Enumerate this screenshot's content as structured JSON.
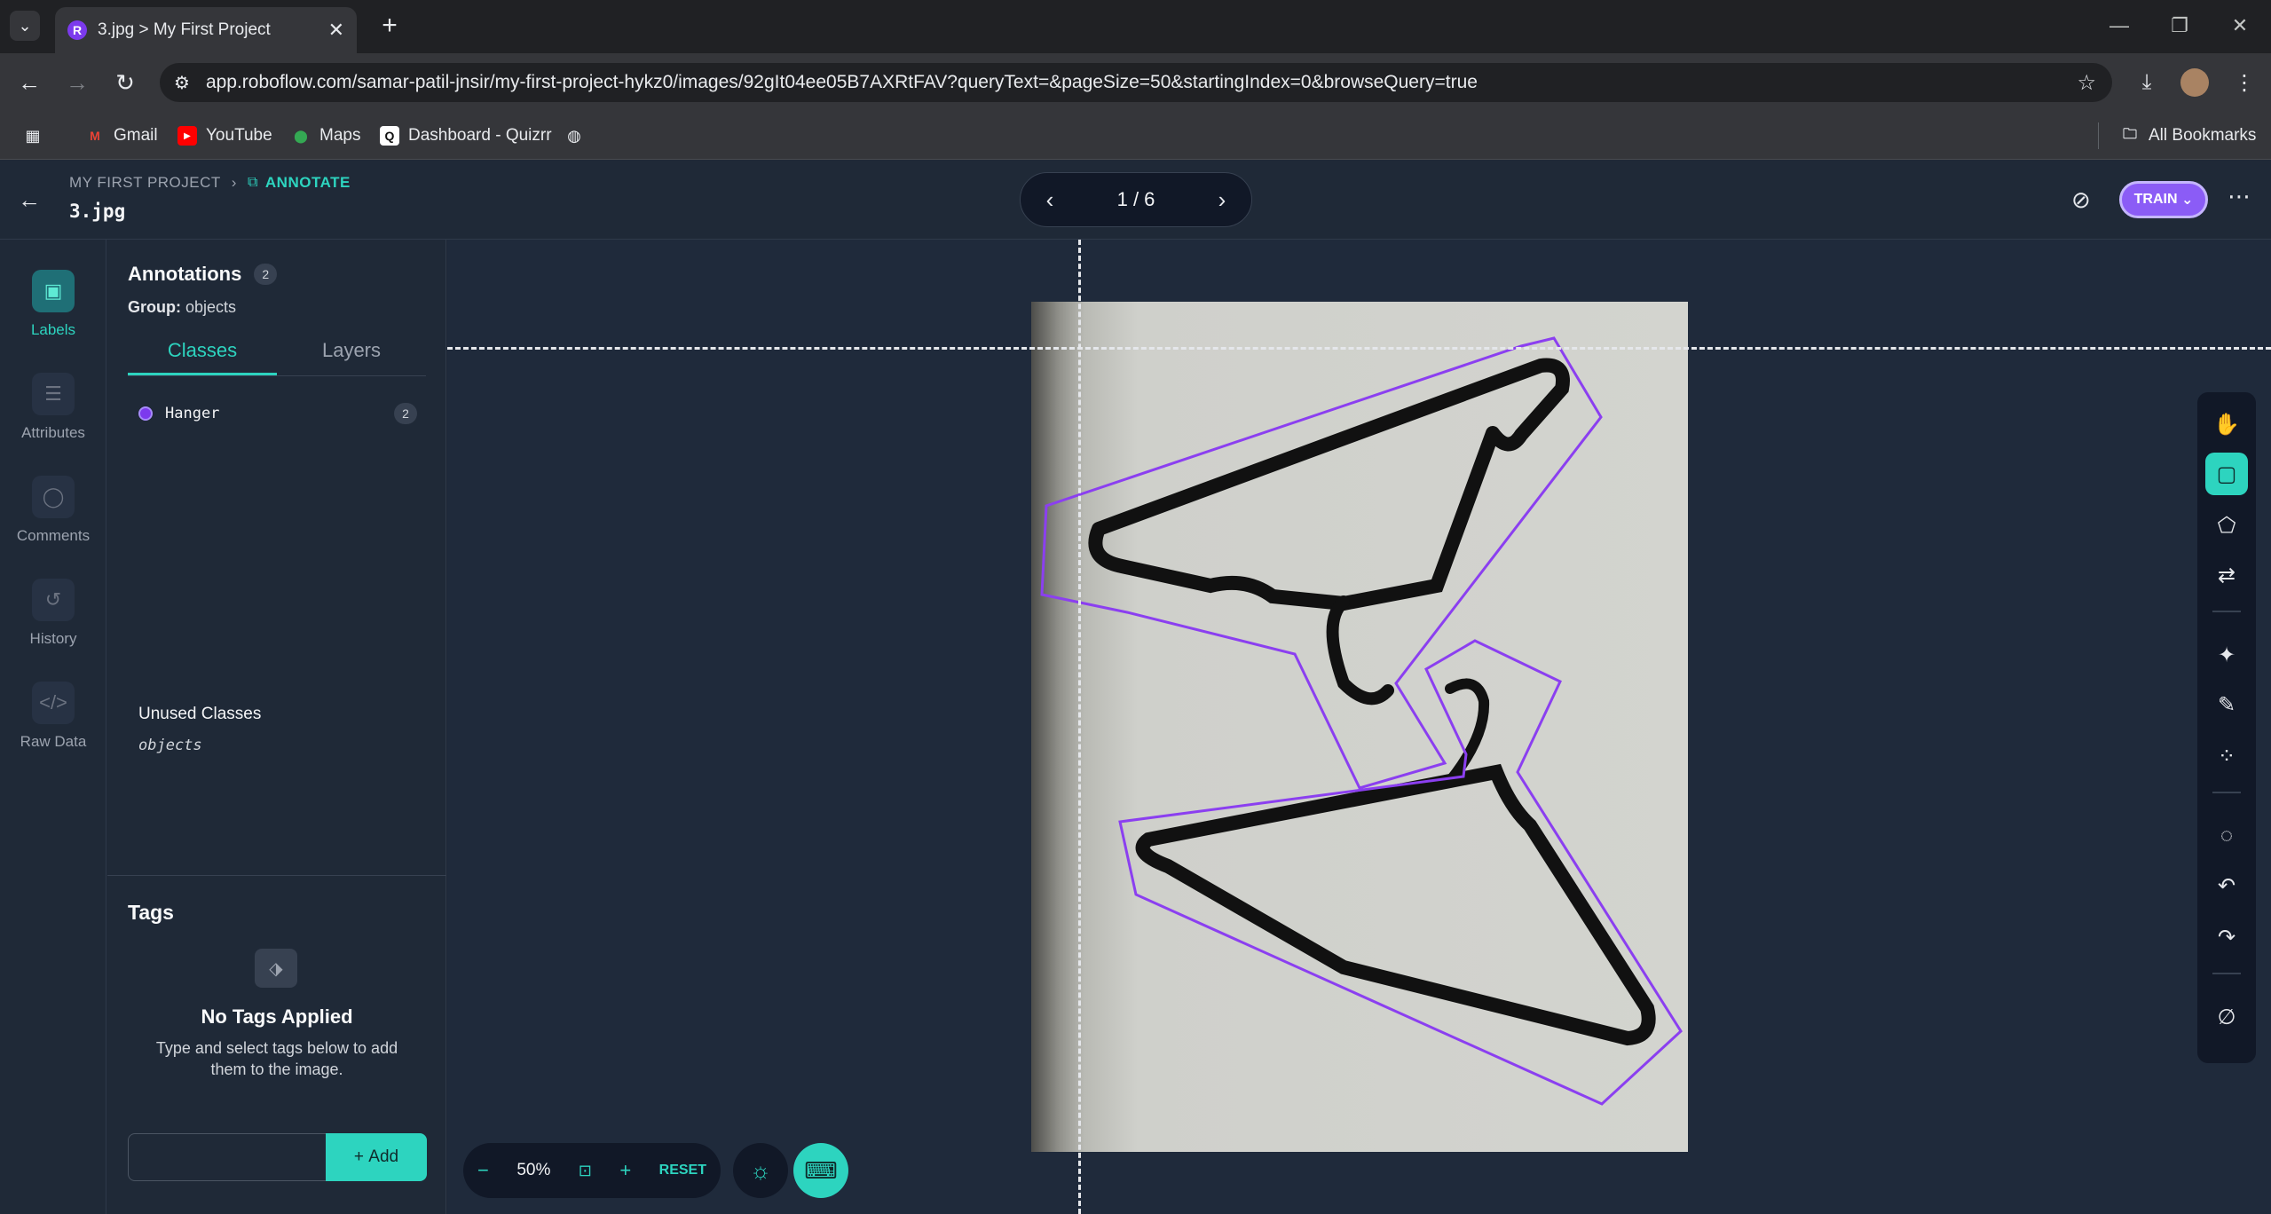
{
  "browser": {
    "tab_title": "3.jpg > My First Project",
    "url": "app.roboflow.com/samar-patil-jnsir/my-first-project-hykz0/images/92gIt04ee05B7AXRtFAV?queryText=&pageSize=50&startingIndex=0&browseQuery=true",
    "bookmarks": [
      "Gmail",
      "YouTube",
      "Maps",
      "Dashboard - Quizrr"
    ],
    "all_bookmarks": "All Bookmarks"
  },
  "header": {
    "project": "MY FIRST PROJECT",
    "section": "ANNOTATE",
    "file_name": "3.jpg",
    "pager": "1 / 6",
    "train_label": "TRAIN"
  },
  "rail": {
    "items": [
      {
        "label": "Labels",
        "icon": "label-icon",
        "active": true
      },
      {
        "label": "Attributes",
        "icon": "list-icon"
      },
      {
        "label": "Comments",
        "icon": "comment-icon"
      },
      {
        "label": "History",
        "icon": "history-icon"
      },
      {
        "label": "Raw Data",
        "icon": "code-icon"
      }
    ]
  },
  "panel": {
    "annotations_title": "Annotations",
    "annotations_count": "2",
    "group_label": "Group:",
    "group_value": "objects",
    "tabs": [
      "Classes",
      "Layers"
    ],
    "classes": [
      {
        "name": "Hanger",
        "count": "2",
        "color": "#7c3aed"
      }
    ],
    "unused_title": "Unused Classes",
    "unused_classes": [
      "objects"
    ],
    "tags_title": "Tags",
    "no_tags_title": "No Tags Applied",
    "no_tags_desc": "Type and select tags below to add them to the image.",
    "tag_input_value": "",
    "add_label": "Add"
  },
  "canvas": {
    "zoom": "50%",
    "reset_label": "RESET",
    "annotation_color": "#8b3ff0"
  },
  "colors": {
    "accent": "#2dd4bf",
    "train": "#8b5cf6"
  }
}
